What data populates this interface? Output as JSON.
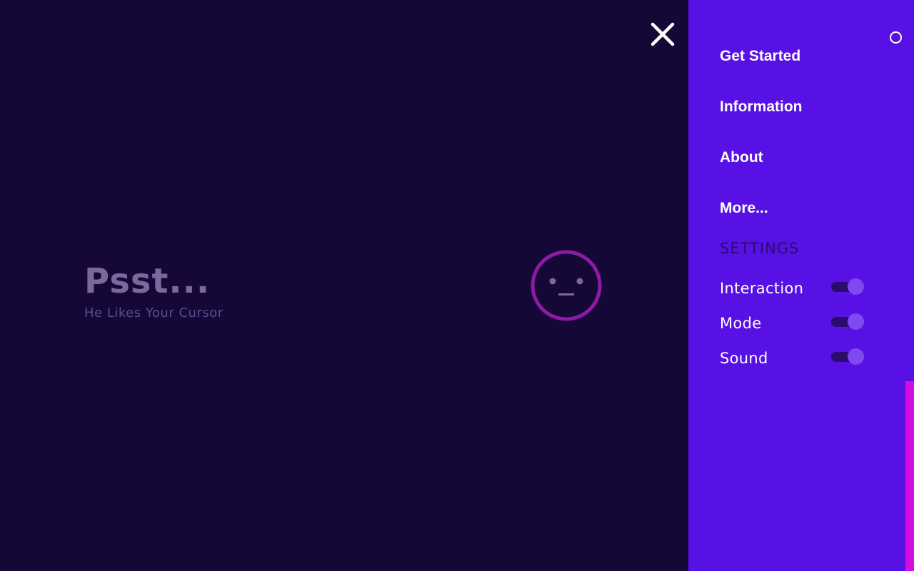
{
  "hero": {
    "title": "Psst...",
    "subtitle": "He Likes Your Cursor"
  },
  "face": {
    "icon": "neutral-face-icon",
    "ring_color": "#8d1ba6",
    "feature_color": "#7d679f"
  },
  "close_button": {
    "icon": "close-icon"
  },
  "menu": {
    "items": [
      {
        "label": "Get Started"
      },
      {
        "label": "Information"
      },
      {
        "label": "About"
      },
      {
        "label": "More..."
      }
    ],
    "settings_heading": "SETTINGS",
    "settings": [
      {
        "label": "Interaction",
        "enabled": true
      },
      {
        "label": "Mode",
        "enabled": true
      },
      {
        "label": "Sound",
        "enabled": true
      }
    ]
  },
  "colors": {
    "background": "#150736",
    "panel": "#5711e5",
    "accent": "#d20ee0",
    "toggle_track": "#2c0b6d",
    "toggle_knob": "#7f48f0"
  }
}
